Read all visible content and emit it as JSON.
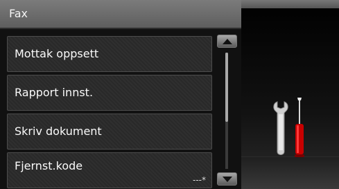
{
  "header": {
    "title": "Fax"
  },
  "menu": {
    "items": [
      {
        "label": "Mottak oppsett"
      },
      {
        "label": "Rapport innst."
      },
      {
        "label": "Skriv dokument"
      },
      {
        "label": "Fjernst.kode",
        "value": "---*"
      }
    ]
  },
  "scrollbar": {
    "position": 0.0
  },
  "right_panel": {
    "icon": "tools-icon"
  }
}
